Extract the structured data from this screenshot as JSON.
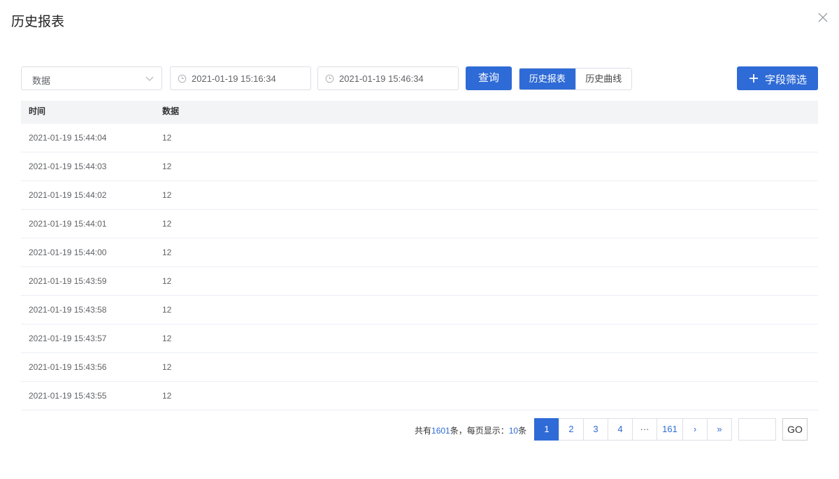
{
  "dialog": {
    "title": "历史报表"
  },
  "toolbar": {
    "field_select": {
      "value": "数据"
    },
    "start_time": "2021-01-19 15:16:34",
    "end_time": "2021-01-19 15:46:34",
    "query_label": "查询",
    "tabs": [
      {
        "label": "历史报表",
        "active": true
      },
      {
        "label": "历史曲线",
        "active": false
      }
    ],
    "filter_label": "字段筛选"
  },
  "table": {
    "columns": [
      "时间",
      "数据"
    ],
    "rows": [
      {
        "time": "2021-01-19 15:44:04",
        "value": "12"
      },
      {
        "time": "2021-01-19 15:44:03",
        "value": "12"
      },
      {
        "time": "2021-01-19 15:44:02",
        "value": "12"
      },
      {
        "time": "2021-01-19 15:44:01",
        "value": "12"
      },
      {
        "time": "2021-01-19 15:44:00",
        "value": "12"
      },
      {
        "time": "2021-01-19 15:43:59",
        "value": "12"
      },
      {
        "time": "2021-01-19 15:43:58",
        "value": "12"
      },
      {
        "time": "2021-01-19 15:43:57",
        "value": "12"
      },
      {
        "time": "2021-01-19 15:43:56",
        "value": "12"
      },
      {
        "time": "2021-01-19 15:43:55",
        "value": "12"
      }
    ]
  },
  "pagination": {
    "total_prefix": "共有",
    "total": "1601",
    "total_suffix": "条，每页显示：",
    "page_size": "10",
    "page_size_suffix": "条",
    "pages": [
      "1",
      "2",
      "3",
      "4",
      "···",
      "161"
    ],
    "current": "1",
    "next": "›",
    "last": "»",
    "goto_value": "",
    "go_label": "GO"
  },
  "colors": {
    "primary": "#2f6bd6",
    "header_bg": "#f3f4f6",
    "border": "#dcdfe6"
  }
}
